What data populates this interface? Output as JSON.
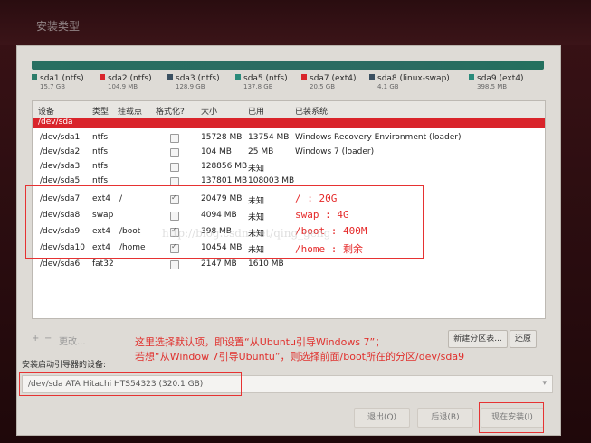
{
  "window": {
    "title": "安装类型"
  },
  "disk_bar": {
    "color_main": "#286f61",
    "legend": [
      {
        "name": "sda1 (ntfs)",
        "size": "15.7 GB",
        "color": "#2c7c69"
      },
      {
        "name": "sda2 (ntfs)",
        "size": "104.9 MB",
        "color": "#d9242b"
      },
      {
        "name": "sda3 (ntfs)",
        "size": "128.9 GB",
        "color": "#3b5061"
      },
      {
        "name": "sda5 (ntfs)",
        "size": "137.8 GB",
        "color": "#2a8b7b"
      },
      {
        "name": "sda7 (ext4)",
        "size": "20.5 GB",
        "color": "#d9242b"
      },
      {
        "name": "sda8 (linux-swap)",
        "size": "4.1 GB",
        "color": "#3b5061"
      },
      {
        "name": "sda9 (ext4)",
        "size": "398.5 MB",
        "color": "#2a8b7b"
      }
    ]
  },
  "table": {
    "headers": {
      "device": "设备",
      "type": "类型",
      "mount": "挂载点",
      "format": "格式化?",
      "size": "大小",
      "used": "已用",
      "system": "已装系统"
    },
    "disk_label": "/dev/sda",
    "rows": [
      {
        "device": "/dev/sda1",
        "type": "ntfs",
        "mount": "",
        "format": false,
        "size": "15728 MB",
        "used": "13754 MB",
        "system": "Windows Recovery Environment (loader)"
      },
      {
        "device": "/dev/sda2",
        "type": "ntfs",
        "mount": "",
        "format": false,
        "size": "104 MB",
        "used": "25 MB",
        "system": "Windows 7 (loader)"
      },
      {
        "device": "/dev/sda3",
        "type": "ntfs",
        "mount": "",
        "format": false,
        "size": "128856 MB",
        "used": "未知",
        "system": ""
      },
      {
        "device": "/dev/sda5",
        "type": "ntfs",
        "mount": "",
        "format": false,
        "size": "137801 MB",
        "used": "108003 MB",
        "system": ""
      },
      {
        "device": "/dev/sda7",
        "type": "ext4",
        "mount": "/",
        "format": true,
        "size": "20479 MB",
        "used": "未知",
        "system": ""
      },
      {
        "device": "/dev/sda8",
        "type": "swap",
        "mount": "",
        "format": false,
        "size": "4094 MB",
        "used": "未知",
        "system": ""
      },
      {
        "device": "/dev/sda9",
        "type": "ext4",
        "mount": "/boot",
        "format": true,
        "size": "398 MB",
        "used": "未知",
        "system": ""
      },
      {
        "device": "/dev/sda10",
        "type": "ext4",
        "mount": "/home",
        "format": true,
        "size": "10454 MB",
        "used": "未知",
        "system": ""
      },
      {
        "device": "/dev/sda6",
        "type": "fat32",
        "mount": "",
        "format": false,
        "size": "2147 MB",
        "used": "1610 MB",
        "system": ""
      }
    ]
  },
  "annotations": {
    "lines": [
      "/ : 20G",
      "swap : 4G",
      "/boot : 400M",
      "/home : 剩余"
    ],
    "note_line1": "这里选择默认项，即设置“从Ubuntu引导Windows 7”；",
    "note_line2": "若想“从Window 7引导Ubuntu”，则选择前面/boot所在的分区/dev/sda9",
    "watermark": "http://blog.csdn.net/qing_geng"
  },
  "toolbar": {
    "add": "+",
    "remove": "−",
    "change": "更改...",
    "new_table": "新建分区表...",
    "revert": "还原"
  },
  "boot": {
    "label": "安装启动引导器的设备:",
    "value": "/dev/sda   ATA Hitachi HTS54323 (320.1 GB)"
  },
  "buttons": {
    "quit": "退出(Q)",
    "back": "后退(B)",
    "install": "现在安装(I)"
  }
}
